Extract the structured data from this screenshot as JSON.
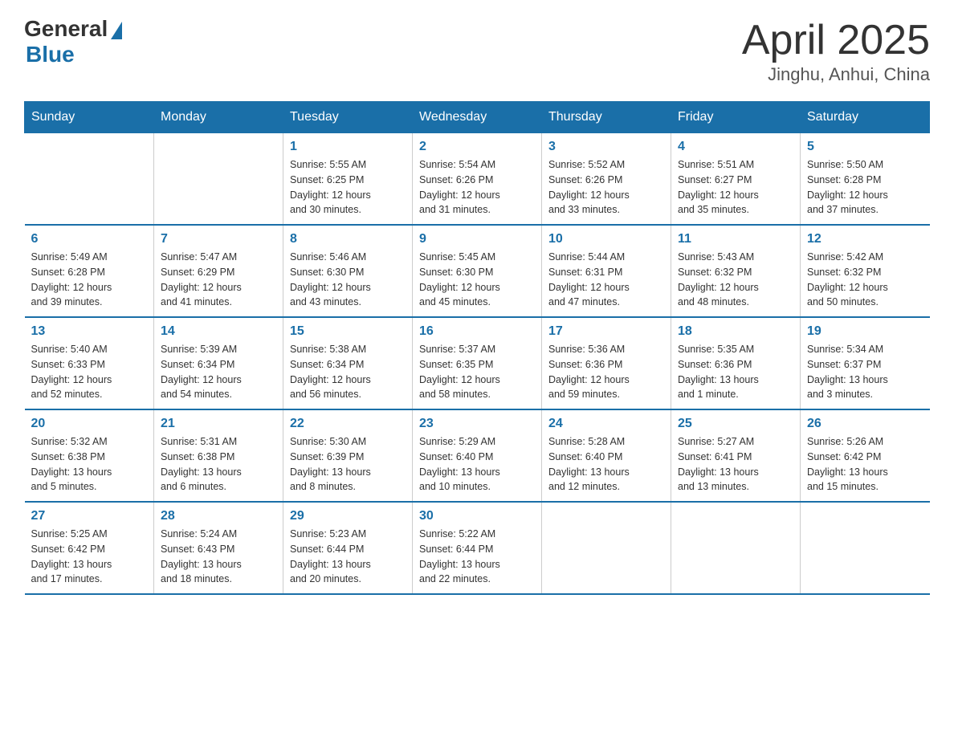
{
  "header": {
    "logo_general": "General",
    "logo_blue": "Blue",
    "title": "April 2025",
    "subtitle": "Jinghu, Anhui, China"
  },
  "weekdays": [
    "Sunday",
    "Monday",
    "Tuesday",
    "Wednesday",
    "Thursday",
    "Friday",
    "Saturday"
  ],
  "weeks": [
    [
      {
        "day": "",
        "info": ""
      },
      {
        "day": "",
        "info": ""
      },
      {
        "day": "1",
        "info": "Sunrise: 5:55 AM\nSunset: 6:25 PM\nDaylight: 12 hours\nand 30 minutes."
      },
      {
        "day": "2",
        "info": "Sunrise: 5:54 AM\nSunset: 6:26 PM\nDaylight: 12 hours\nand 31 minutes."
      },
      {
        "day": "3",
        "info": "Sunrise: 5:52 AM\nSunset: 6:26 PM\nDaylight: 12 hours\nand 33 minutes."
      },
      {
        "day": "4",
        "info": "Sunrise: 5:51 AM\nSunset: 6:27 PM\nDaylight: 12 hours\nand 35 minutes."
      },
      {
        "day": "5",
        "info": "Sunrise: 5:50 AM\nSunset: 6:28 PM\nDaylight: 12 hours\nand 37 minutes."
      }
    ],
    [
      {
        "day": "6",
        "info": "Sunrise: 5:49 AM\nSunset: 6:28 PM\nDaylight: 12 hours\nand 39 minutes."
      },
      {
        "day": "7",
        "info": "Sunrise: 5:47 AM\nSunset: 6:29 PM\nDaylight: 12 hours\nand 41 minutes."
      },
      {
        "day": "8",
        "info": "Sunrise: 5:46 AM\nSunset: 6:30 PM\nDaylight: 12 hours\nand 43 minutes."
      },
      {
        "day": "9",
        "info": "Sunrise: 5:45 AM\nSunset: 6:30 PM\nDaylight: 12 hours\nand 45 minutes."
      },
      {
        "day": "10",
        "info": "Sunrise: 5:44 AM\nSunset: 6:31 PM\nDaylight: 12 hours\nand 47 minutes."
      },
      {
        "day": "11",
        "info": "Sunrise: 5:43 AM\nSunset: 6:32 PM\nDaylight: 12 hours\nand 48 minutes."
      },
      {
        "day": "12",
        "info": "Sunrise: 5:42 AM\nSunset: 6:32 PM\nDaylight: 12 hours\nand 50 minutes."
      }
    ],
    [
      {
        "day": "13",
        "info": "Sunrise: 5:40 AM\nSunset: 6:33 PM\nDaylight: 12 hours\nand 52 minutes."
      },
      {
        "day": "14",
        "info": "Sunrise: 5:39 AM\nSunset: 6:34 PM\nDaylight: 12 hours\nand 54 minutes."
      },
      {
        "day": "15",
        "info": "Sunrise: 5:38 AM\nSunset: 6:34 PM\nDaylight: 12 hours\nand 56 minutes."
      },
      {
        "day": "16",
        "info": "Sunrise: 5:37 AM\nSunset: 6:35 PM\nDaylight: 12 hours\nand 58 minutes."
      },
      {
        "day": "17",
        "info": "Sunrise: 5:36 AM\nSunset: 6:36 PM\nDaylight: 12 hours\nand 59 minutes."
      },
      {
        "day": "18",
        "info": "Sunrise: 5:35 AM\nSunset: 6:36 PM\nDaylight: 13 hours\nand 1 minute."
      },
      {
        "day": "19",
        "info": "Sunrise: 5:34 AM\nSunset: 6:37 PM\nDaylight: 13 hours\nand 3 minutes."
      }
    ],
    [
      {
        "day": "20",
        "info": "Sunrise: 5:32 AM\nSunset: 6:38 PM\nDaylight: 13 hours\nand 5 minutes."
      },
      {
        "day": "21",
        "info": "Sunrise: 5:31 AM\nSunset: 6:38 PM\nDaylight: 13 hours\nand 6 minutes."
      },
      {
        "day": "22",
        "info": "Sunrise: 5:30 AM\nSunset: 6:39 PM\nDaylight: 13 hours\nand 8 minutes."
      },
      {
        "day": "23",
        "info": "Sunrise: 5:29 AM\nSunset: 6:40 PM\nDaylight: 13 hours\nand 10 minutes."
      },
      {
        "day": "24",
        "info": "Sunrise: 5:28 AM\nSunset: 6:40 PM\nDaylight: 13 hours\nand 12 minutes."
      },
      {
        "day": "25",
        "info": "Sunrise: 5:27 AM\nSunset: 6:41 PM\nDaylight: 13 hours\nand 13 minutes."
      },
      {
        "day": "26",
        "info": "Sunrise: 5:26 AM\nSunset: 6:42 PM\nDaylight: 13 hours\nand 15 minutes."
      }
    ],
    [
      {
        "day": "27",
        "info": "Sunrise: 5:25 AM\nSunset: 6:42 PM\nDaylight: 13 hours\nand 17 minutes."
      },
      {
        "day": "28",
        "info": "Sunrise: 5:24 AM\nSunset: 6:43 PM\nDaylight: 13 hours\nand 18 minutes."
      },
      {
        "day": "29",
        "info": "Sunrise: 5:23 AM\nSunset: 6:44 PM\nDaylight: 13 hours\nand 20 minutes."
      },
      {
        "day": "30",
        "info": "Sunrise: 5:22 AM\nSunset: 6:44 PM\nDaylight: 13 hours\nand 22 minutes."
      },
      {
        "day": "",
        "info": ""
      },
      {
        "day": "",
        "info": ""
      },
      {
        "day": "",
        "info": ""
      }
    ]
  ]
}
